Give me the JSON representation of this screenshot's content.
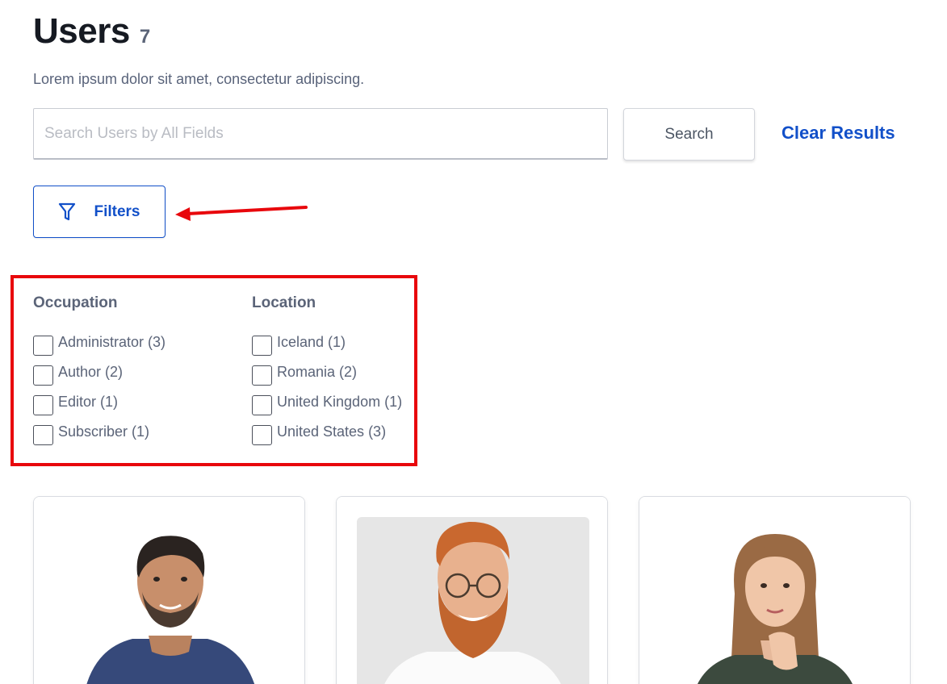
{
  "header": {
    "title": "Users",
    "count": "7",
    "subtitle": "Lorem ipsum dolor sit amet, consectetur adipiscing."
  },
  "search": {
    "placeholder": "Search Users by All Fields",
    "value": "",
    "button_label": "Search",
    "clear_label": "Clear Results"
  },
  "filters": {
    "button_label": "Filters",
    "groups": [
      {
        "heading": "Occupation",
        "options": [
          "Administrator (3)",
          "Author (2)",
          "Editor (1)",
          "Subscriber (1)"
        ]
      },
      {
        "heading": "Location",
        "options": [
          "Iceland (1)",
          "Romania (2)",
          "United Kingdom (1)",
          "United States (3)"
        ]
      }
    ]
  },
  "colors": {
    "accent": "#1250c9",
    "annotation": "#e8070c",
    "muted_text": "#5b6478"
  },
  "cards": [
    {
      "photo": "man-dark-hair-beard-navy-tshirt"
    },
    {
      "photo": "man-red-beard-glasses-white-tshirt"
    },
    {
      "photo": "woman-long-hair-hand-on-chin"
    }
  ]
}
